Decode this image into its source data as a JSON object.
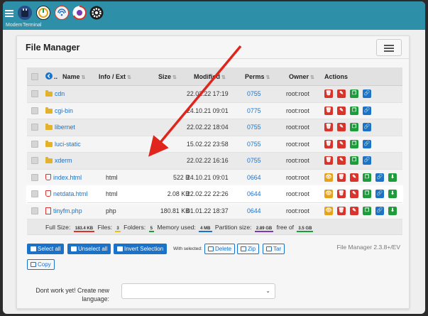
{
  "topbar": {
    "labels": [
      "Modem",
      "Terminal"
    ]
  },
  "card": {
    "title": "File Manager"
  },
  "table": {
    "headers": {
      "name": "Name",
      "info": "Info / Ext",
      "size": "Size",
      "modified": "Modified",
      "perms": "Perms",
      "owner": "Owner",
      "actions": "Actions"
    },
    "up_dots": "..",
    "rows": [
      {
        "name": "cdn",
        "type": "folder",
        "info": "",
        "size": "",
        "modified": "22.02.22 17:19",
        "perms": "0755",
        "owner": "root:root"
      },
      {
        "name": "cgi-bin",
        "type": "folder",
        "info": "",
        "size": "",
        "modified": "24.10.21 09:01",
        "perms": "0775",
        "owner": "root:root"
      },
      {
        "name": "libernet",
        "type": "folder",
        "info": "",
        "size": "",
        "modified": "22.02.22 18:04",
        "perms": "0755",
        "owner": "root:root"
      },
      {
        "name": "luci-static",
        "type": "folder",
        "info": "",
        "size": "",
        "modified": "15.02.22 23:58",
        "perms": "0755",
        "owner": "root:root"
      },
      {
        "name": "xderm",
        "type": "folder",
        "info": "",
        "size": "",
        "modified": "22.02.22 16:16",
        "perms": "0755",
        "owner": "root:root"
      },
      {
        "name": "index.html",
        "type": "html",
        "info": "html",
        "size": "522  B",
        "modified": "24.10.21 09:01",
        "perms": "0664",
        "owner": "root:root"
      },
      {
        "name": "netdata.html",
        "type": "html",
        "info": "html",
        "size": "2.08 KB",
        "modified": "22.02.22 22:26",
        "perms": "0644",
        "owner": "root:root"
      },
      {
        "name": "tinyfm.php",
        "type": "php",
        "info": "php",
        "size": "180.81 KB",
        "modified": "01.01.22 18:37",
        "perms": "0644",
        "owner": "root:root"
      }
    ],
    "footer": {
      "full_size_label": "Full Size:",
      "full_size": "183.4 KB",
      "files_label": "Files:",
      "files": "3",
      "folders_label": "Folders:",
      "folders": "5",
      "memory_label": "Memory used:",
      "memory": "4 MB",
      "partition_label": "Partition size:",
      "partition": "2.89 GB",
      "free_label": "free of",
      "free": "3.5 GB"
    }
  },
  "buttons": {
    "select_all": "Select all",
    "unselect_all": "Unselect all",
    "invert_selection": "Invert Selection",
    "with_selected": "With selected:",
    "delete": "Delete",
    "zip": "Zip",
    "tar": "Tar",
    "copy": "Copy"
  },
  "version": "File Manager 2.3.8+/EV",
  "language": {
    "label": "Dont work yet! Create new language:",
    "selected": ""
  },
  "colors": {
    "topbar": "#2e8fa8",
    "accent": "#1a72c9",
    "danger": "#d9342b",
    "success": "#1e9b3a",
    "warning": "#e8a21a",
    "annotation_arrow": "#e0261c"
  }
}
